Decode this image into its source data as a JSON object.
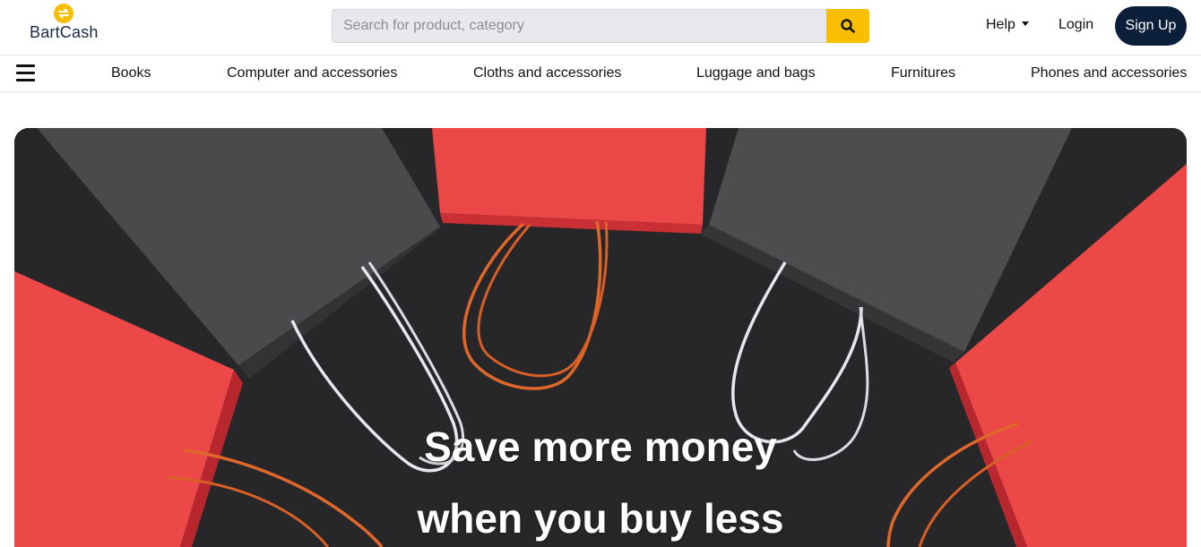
{
  "brand": {
    "name": "BartCash",
    "accent": "#f7bf00",
    "navy": "#0b1f3a"
  },
  "search": {
    "placeholder": "Search for product, category",
    "value": "",
    "icon": "search-icon"
  },
  "header": {
    "help_label": "Help",
    "login_label": "Login",
    "signup_label": "Sign Up"
  },
  "categories": [
    "Books",
    "Computer and accessories",
    "Cloths and accessories",
    "Luggage and bags",
    "Furnitures",
    "Phones and accessories"
  ],
  "hero": {
    "line1": "Save more money",
    "line2": "when you buy less",
    "bag_colors": {
      "red": "#ee4444",
      "gray": "#4a4a4d",
      "background": "#262626",
      "orange_handle": "#e0672a",
      "white_handle": "#e8e8ee"
    }
  }
}
